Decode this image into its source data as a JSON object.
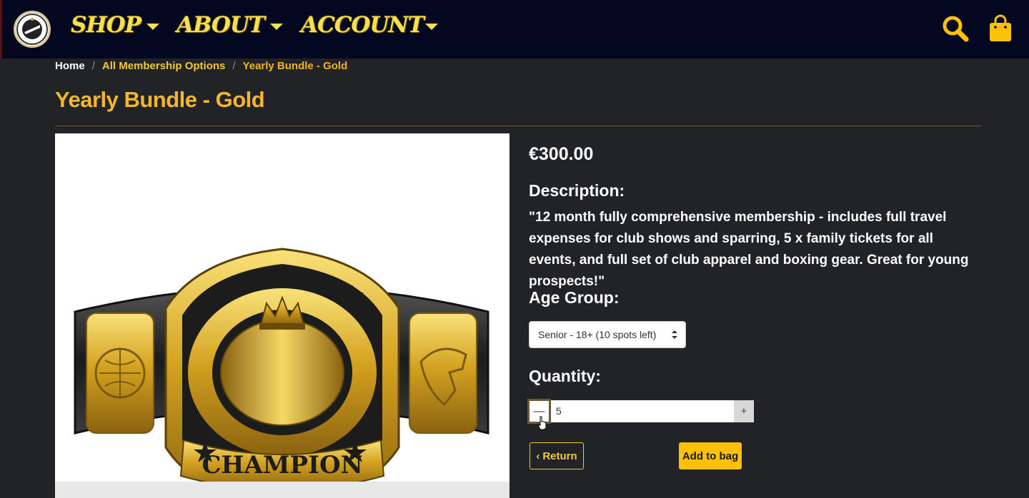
{
  "nav": {
    "menu": [
      {
        "label": "SHOP"
      },
      {
        "label": "ABOUT"
      },
      {
        "label": "ACCOUNT"
      }
    ],
    "icons": {
      "logo": "club-logo",
      "search": "search-icon",
      "bag": "shopping-bag-icon"
    },
    "accent_color": "#f7e04a"
  },
  "breadcrumb": {
    "home": "Home",
    "category": "All Membership Options",
    "current": "Yearly Bundle - Gold"
  },
  "product": {
    "title": "Yearly Bundle - Gold",
    "price": "€300.00",
    "description_label": "Description:",
    "description": "\"12 month fully comprehensive membership - includes full travel expenses for club shows and sparring, 5 x family tickets for all events, and full set of club apparel and boxing gear. Great for young prospects!\"",
    "image_text": "CHAMPION",
    "age_label": "Age Group:",
    "age_selected": "Senior - 18+ (10 spots left)",
    "quantity_label": "Quantity:",
    "quantity_value": "5",
    "minus_symbol": "—",
    "plus_symbol": "+",
    "return_label": "Return",
    "add_label": "Add to bag"
  },
  "colors": {
    "title": "#f4b62d",
    "button": "#ffc107",
    "nav_bg": "#030720",
    "page_bg": "#222326"
  }
}
